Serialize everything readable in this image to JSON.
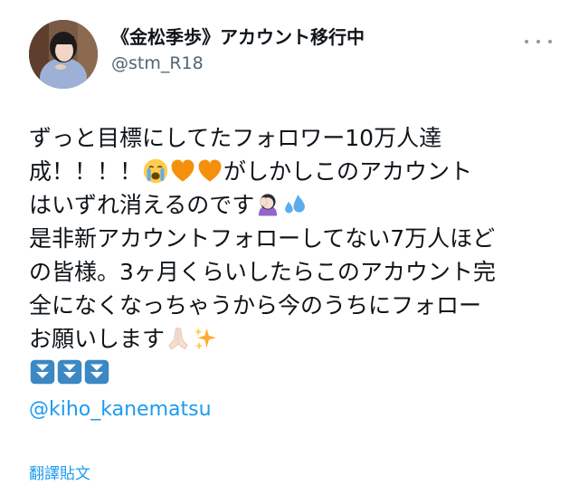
{
  "author": {
    "display_name": "《金松季歩》アカウント移行中",
    "handle": "@stm_R18"
  },
  "tweet": {
    "line1": "ずっと目標にしてたフォロワー10万人達",
    "line2a": "成！！！！",
    "line2b": "がしかしこのアカウント",
    "line3": "はいずれ消えるのです",
    "line4": "是非新アカウントフォローしてない7万人ほど",
    "line5": "の皆様。3ヶ月くらいしたらこのアカウント完",
    "line6": "全になくなっちゃうから今のうちにフォロー",
    "line7": "お願いします"
  },
  "icons": {
    "line2": [
      "loudly-crying-face-icon",
      "orange-heart-icon",
      "orange-heart-icon"
    ],
    "line3": [
      "woman-facepalming-icon",
      "sweat-droplets-icon"
    ],
    "line7": [
      "folded-hands-icon",
      "sparkles-icon"
    ],
    "line8": [
      "down-arrow-button-icon",
      "down-arrow-button-icon",
      "down-arrow-button-icon"
    ]
  },
  "mention": "@kiho_kanematsu",
  "translate_label": "翻譯貼文",
  "colors": {
    "link": "#1d9bf0",
    "secondary_text": "#536471",
    "text": "#0f1419",
    "heart": "#f4900c",
    "arrow_button": "#3b88c3"
  }
}
